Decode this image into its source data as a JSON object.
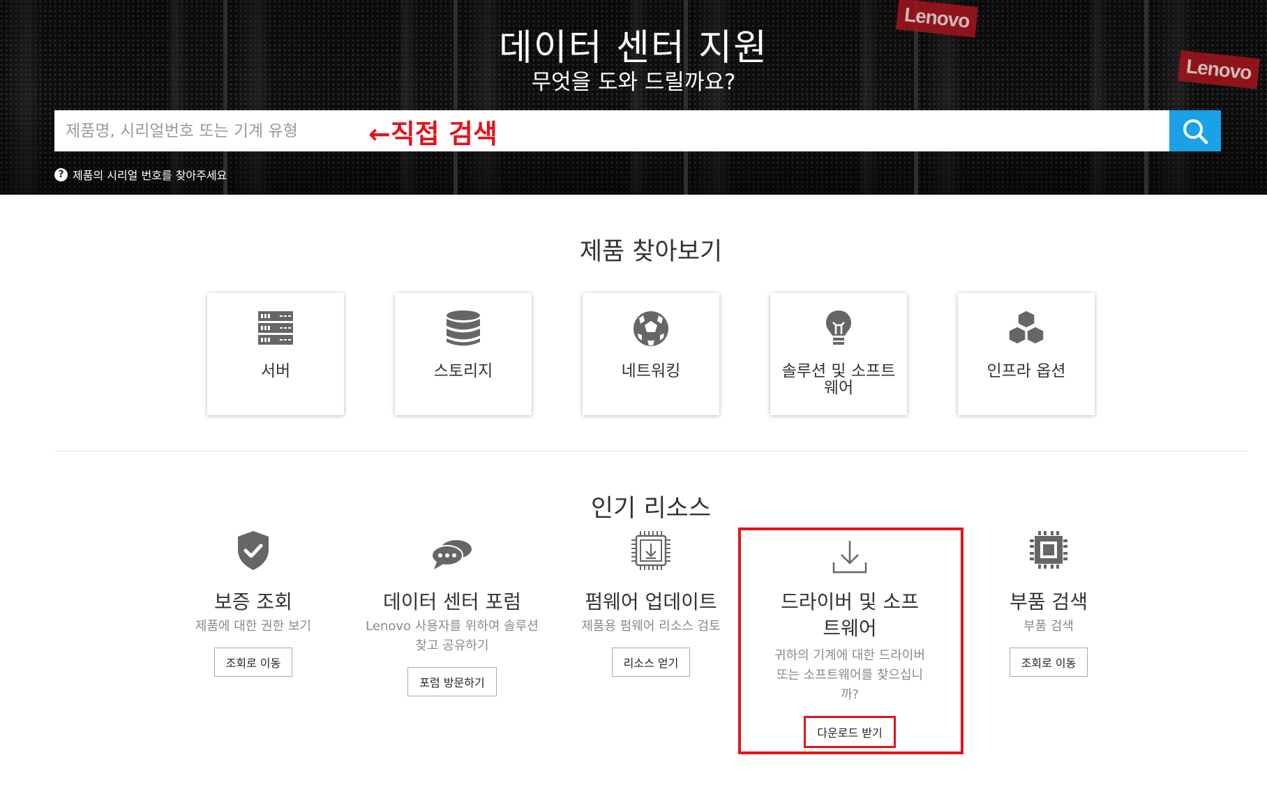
{
  "hero": {
    "title": "데이터 센터 지원",
    "subtitle": "무엇을 도와 드릴까요?",
    "brand_tags": [
      "Lenovo",
      "Lenovo"
    ],
    "search": {
      "placeholder": "제품명, 시리얼번호 또는 기계 유형",
      "annotation": "←직접 검색",
      "button_icon": "search-icon"
    },
    "help_text": "제품의 시리얼 번호를 찾아주세요",
    "help_icon_glyph": "?"
  },
  "browse": {
    "title": "제품 찾아보기",
    "cards": [
      {
        "label": "서버",
        "icon": "server-icon"
      },
      {
        "label": "스토리지",
        "icon": "database-icon"
      },
      {
        "label": "네트워킹",
        "icon": "network-globe-icon"
      },
      {
        "label": "솔루션 및 소프트웨어",
        "icon": "lightbulb-icon"
      },
      {
        "label": "인프라 옵션",
        "icon": "cubes-icon"
      }
    ]
  },
  "resources": {
    "title": "인기 리소스",
    "items": [
      {
        "title": "보증 조회",
        "desc": "제품에 대한 권한 보기",
        "button": "조회로 이동",
        "icon": "shield-check-icon"
      },
      {
        "title": "데이터 센터 포럼",
        "desc": "Lenovo 사용자를 위하여 솔루션 찾고 공유하기",
        "button": "포럼 방문하기",
        "icon": "chat-bubbles-icon"
      },
      {
        "title": "펌웨어 업데이트",
        "desc": "제품용 펌웨어 리소스 검토",
        "button": "리소스 얻기",
        "icon": "firmware-chip-icon"
      },
      {
        "title": "드라이버 및 소프트웨어",
        "desc": "귀하의 기계에 대한 드라이버 또는 소프트웨어를 찾으십니까?",
        "button": "다운로드 받기",
        "icon": "download-icon"
      },
      {
        "title": "부품 검색",
        "desc": "부품 검색",
        "button": "조회로 이동",
        "icon": "cpu-chip-icon"
      }
    ]
  },
  "colors": {
    "accent_blue": "#1aa1e6",
    "annotation_red": "#e3141b",
    "icon_gray": "#666666"
  }
}
